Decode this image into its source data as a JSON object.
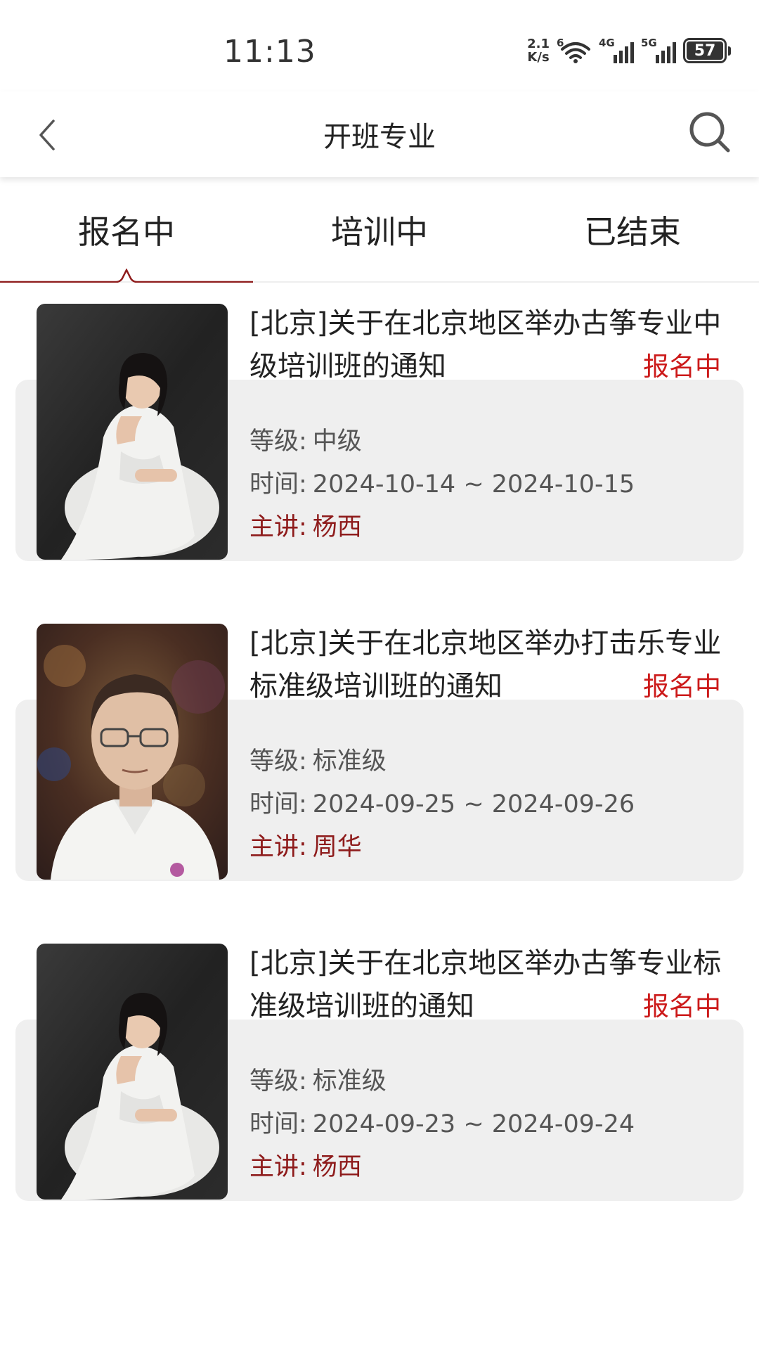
{
  "status_bar": {
    "time": "11:13",
    "net_speed_value": "2.1",
    "net_speed_unit": "K/s",
    "wifi_label": "6",
    "sim1_label": "4G",
    "sim2_label": "5G",
    "battery": "57"
  },
  "header": {
    "title": "开班专业",
    "back_icon": "chevron-left-icon",
    "search_icon": "search-icon"
  },
  "tabs": [
    {
      "label": "报名中",
      "active": true
    },
    {
      "label": "培训中",
      "active": false
    },
    {
      "label": "已结束",
      "active": false
    }
  ],
  "colors": {
    "accent": "#8e1b1b",
    "status_red": "#cc1a1a",
    "panel_bg": "#efefef"
  },
  "courses": [
    {
      "title": "[北京]关于在北京地区举办古筝专业中级培训班的通知",
      "status": "报名中",
      "level_label": "等级:",
      "level": "中级",
      "time_label": "时间:",
      "time": "2024-10-14 ~ 2024-10-15",
      "lecturer_label": "主讲:",
      "lecturer": "杨西",
      "photo": "woman-in-white-dress-portrait"
    },
    {
      "title": "[北京]关于在北京地区举办打击乐专业标准级培训班的通知",
      "status": "报名中",
      "level_label": "等级:",
      "level": "标准级",
      "time_label": "时间:",
      "time": "2024-09-25 ~ 2024-09-26",
      "lecturer_label": "主讲:",
      "lecturer": "周华",
      "photo": "man-with-glasses-portrait"
    },
    {
      "title": "[北京]关于在北京地区举办古筝专业标准级培训班的通知",
      "status": "报名中",
      "level_label": "等级:",
      "level": "标准级",
      "time_label": "时间:",
      "time": "2024-09-23 ~ 2024-09-24",
      "lecturer_label": "主讲:",
      "lecturer": "杨西",
      "photo": "woman-in-white-dress-portrait"
    }
  ]
}
